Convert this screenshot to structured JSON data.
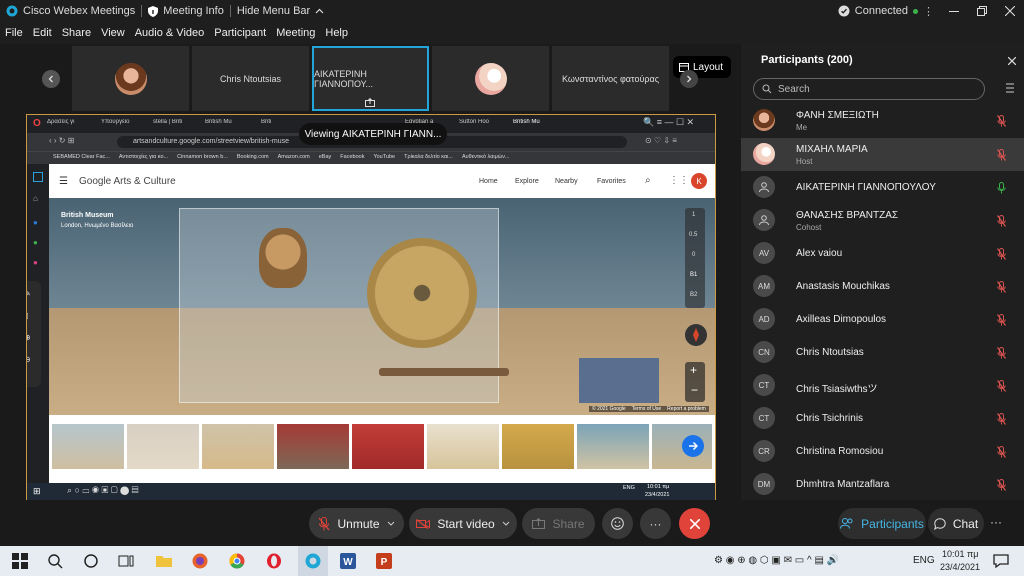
{
  "titlebar": {
    "app": "Cisco Webex Meetings",
    "info": "Meeting Info",
    "hide": "Hide Menu Bar",
    "status": "Connected"
  },
  "menu": [
    "File",
    "Edit",
    "Share",
    "View",
    "Audio & Video",
    "Participant",
    "Meeting",
    "Help"
  ],
  "strip": {
    "tiles": [
      "",
      "Chris Ntoutsias",
      "ΑΙΚΑΤΕΡΙΝΗ ΓΙΑΝΝΟΠΟΥ...",
      "",
      "Κωνσταντίνος φατούρας"
    ],
    "layout": "Layout"
  },
  "share": {
    "viewing": "Viewing ΑΙΚΑΤΕΡΙΝΗ ΓΙΑΝΝ...",
    "tabs": [
      "Δράσεις γι",
      "Υπουργείο",
      "stella | Briti",
      "British Mu",
      "Briti",
      "Egyptian a",
      "Sutton Hoo",
      "British Mu"
    ],
    "url": "artsandculture.google.com/streetview/british-muse",
    "bookmarks": [
      "SEBAMED Clear Fac...",
      "Αντιστοιχίες για κο...",
      "Cinnamon brown b...",
      "Booking.com",
      "Amazon.com",
      "eBay",
      "Facebook",
      "YouTube",
      "Τρίκαλα δελτίο και...",
      "Αυθεντικό λαιμών..."
    ],
    "site": {
      "brand": "Google Arts & Culture",
      "nav": [
        "Home",
        "Explore",
        "Nearby",
        "Favorites"
      ],
      "avatar": "K",
      "museum": "British Museum",
      "location": "London, Ηνωμένο Βασίλειο",
      "levels": [
        "1",
        "0.5",
        "0",
        "B1",
        "B2"
      ],
      "footer": [
        "© 2021 Google",
        "Terms of Use",
        "Report a problem"
      ]
    },
    "taskbar": {
      "lang": "ENG",
      "time": "10:01 πμ",
      "date": "23/4/2021"
    }
  },
  "participants": {
    "title": "Participants (200)",
    "search": "Search",
    "list": [
      {
        "name": "ΦΑΝΗ ΣΜΕΞΙΩΤΗ",
        "role": "Me",
        "initials": ""
      },
      {
        "name": "ΜΙΧΑΗΛ ΜΑΡΙΑ",
        "role": "Host",
        "initials": ""
      },
      {
        "name": "ΑΙΚΑΤΕΡΙΝΗ ΓΙΑΝΝΟΠΟΥΛΟΥ",
        "role": "",
        "initials": ""
      },
      {
        "name": "ΘΑΝΑΣΗΣ ΒΡΑΝΤΖΑΣ",
        "role": "Cohost",
        "initials": ""
      },
      {
        "name": "Alex vaiou",
        "role": "",
        "initials": "AV"
      },
      {
        "name": "Anastasis Mouchikas",
        "role": "",
        "initials": "AM"
      },
      {
        "name": "Axilleas Dimopoulos",
        "role": "",
        "initials": "AD"
      },
      {
        "name": "Chris Ntoutsias",
        "role": "",
        "initials": "CN"
      },
      {
        "name": "Chris Tsiasiwthsツ",
        "role": "",
        "initials": "CT"
      },
      {
        "name": "Chris Tsichrinis",
        "role": "",
        "initials": "CT"
      },
      {
        "name": "Christina Romosiou",
        "role": "",
        "initials": "CR"
      },
      {
        "name": "Dhmhtra Mantzaflara",
        "role": "",
        "initials": "DM"
      }
    ]
  },
  "controls": {
    "unmute": "Unmute",
    "video": "Start video",
    "share": "Share",
    "participants": "Participants",
    "chat": "Chat"
  },
  "taskbar": {
    "lang": "ENG",
    "time": "10:01 πμ",
    "date": "23/4/2021"
  },
  "colors": {
    "accent": "#22a6d9",
    "red": "#e0433a",
    "muted": "#d9534f",
    "green": "#3cb34a"
  }
}
